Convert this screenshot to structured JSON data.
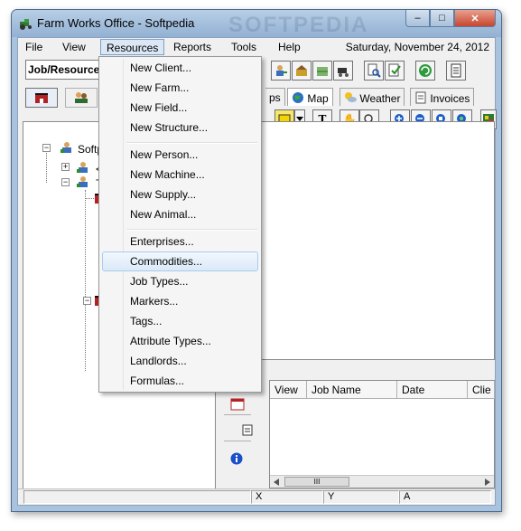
{
  "window": {
    "title": "Farm Works Office - Softpedia",
    "watermark": "SOFTPEDIA",
    "close_glyph": "✕",
    "max_glyph": "□",
    "min_glyph": "–"
  },
  "menubar": {
    "items": [
      "File",
      "View",
      "Resources",
      "Reports",
      "Tools",
      "Help"
    ],
    "active": "Resources",
    "date": "Saturday, November 24, 2012"
  },
  "toolbar": {
    "combo_value": "Job/Resource",
    "text_tool_glyph": "T",
    "pan_tool_glyph": "✋"
  },
  "tabs": {
    "right": [
      {
        "label": "ps",
        "icon": "map-layers-icon"
      },
      {
        "label": "Map",
        "icon": "globe-icon"
      },
      {
        "label": "Weather",
        "icon": "weather-icon"
      },
      {
        "label": "Invoices",
        "icon": "invoice-icon"
      }
    ]
  },
  "tree": {
    "root_label": "Softpe",
    "child1_label": "<",
    "child2_label": "Te"
  },
  "jobs_table": {
    "columns": [
      "View",
      "Job Name",
      "Date",
      "Clie"
    ],
    "scroll_thumb": "III"
  },
  "status": {
    "x_label": "X",
    "y_label": "Y",
    "a_label": "A"
  },
  "resources_menu": {
    "groups": [
      [
        "New Client...",
        "New Farm...",
        "New Field...",
        "New Structure..."
      ],
      [
        "New Person...",
        "New Machine...",
        "New Supply...",
        "New Animal..."
      ],
      [
        "Enterprises...",
        "Commodities...",
        "Job Types...",
        "Markers...",
        "Tags...",
        "Attribute Types...",
        "Landlords...",
        "Formulas..."
      ]
    ],
    "hovered": "Commodities..."
  },
  "colors": {
    "title_gradient_top": "#b8cfe6",
    "menu_highlight": "#dbe7f4",
    "close_button": "#c8452d"
  }
}
